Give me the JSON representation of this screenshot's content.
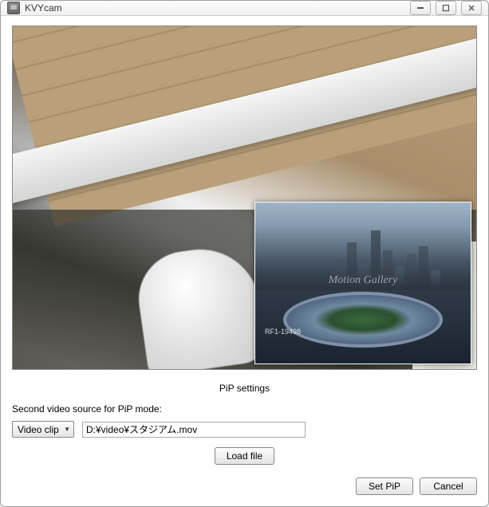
{
  "window": {
    "title": "KVYcam"
  },
  "pip_overlay": {
    "watermark": "Motion Gallery",
    "clip_id": "RF1-19498"
  },
  "settings": {
    "section_title": "PiP settings",
    "source_label": "Second video source for PiP mode:",
    "source_dropdown_value": "Video clip",
    "file_path": "D:¥video¥スタジアム.mov",
    "load_button": "Load file",
    "set_pip_button": "Set PiP",
    "cancel_button": "Cancel"
  }
}
